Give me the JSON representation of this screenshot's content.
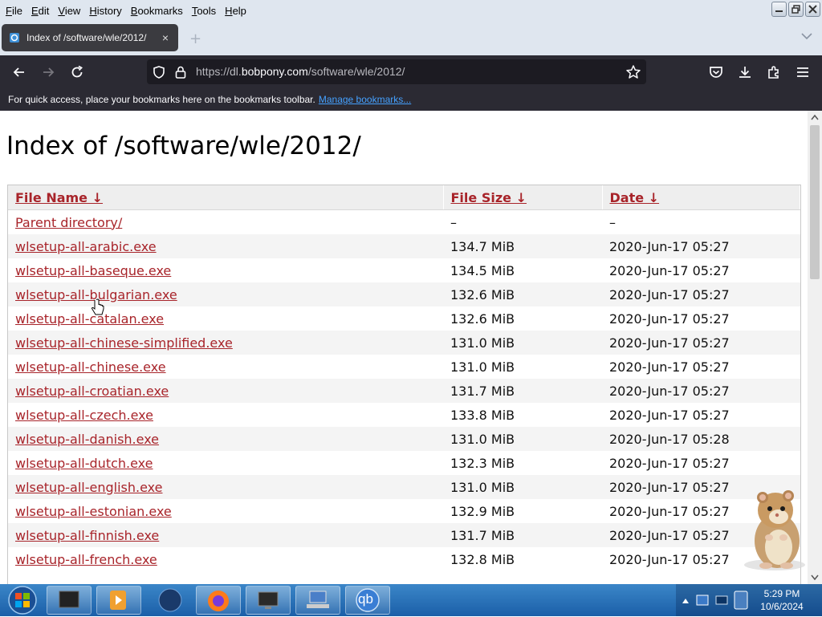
{
  "menu": {
    "items": [
      {
        "key": "F",
        "rest": "ile"
      },
      {
        "key": "E",
        "rest": "dit"
      },
      {
        "key": "V",
        "rest": "iew"
      },
      {
        "key": "H",
        "rest": "istory"
      },
      {
        "key": "B",
        "rest": "ookmarks"
      },
      {
        "key": "T",
        "rest": "ools"
      },
      {
        "key": "H",
        "rest": "elp"
      }
    ]
  },
  "tab": {
    "title": "Index of /software/wle/2012/",
    "close_glyph": "×",
    "new_tab_glyph": "+"
  },
  "url": {
    "prefix": "https://dl.",
    "domain": "bobpony.com",
    "path": "/software/wle/2012/"
  },
  "bookmarks_bar": {
    "message": "For quick access, place your bookmarks here on the bookmarks toolbar.",
    "link": "Manage bookmarks..."
  },
  "page": {
    "heading": "Index of /software/wle/2012/",
    "columns": {
      "name": "File Name  ↓",
      "size": "File Size  ↓",
      "date": "Date  ↓"
    },
    "rows": [
      {
        "name": "Parent directory/",
        "size": "–",
        "date": "–"
      },
      {
        "name": "wlsetup-all-arabic.exe",
        "size": "134.7 MiB",
        "date": "2020-Jun-17 05:27"
      },
      {
        "name": "wlsetup-all-baseque.exe",
        "size": "134.5 MiB",
        "date": "2020-Jun-17 05:27"
      },
      {
        "name": "wlsetup-all-bulgarian.exe",
        "size": "132.6 MiB",
        "date": "2020-Jun-17 05:27"
      },
      {
        "name": "wlsetup-all-catalan.exe",
        "size": "132.6 MiB",
        "date": "2020-Jun-17 05:27"
      },
      {
        "name": "wlsetup-all-chinese-simplified.exe",
        "size": "131.0 MiB",
        "date": "2020-Jun-17 05:27"
      },
      {
        "name": "wlsetup-all-chinese.exe",
        "size": "131.0 MiB",
        "date": "2020-Jun-17 05:27"
      },
      {
        "name": "wlsetup-all-croatian.exe",
        "size": "131.7 MiB",
        "date": "2020-Jun-17 05:27"
      },
      {
        "name": "wlsetup-all-czech.exe",
        "size": "133.8 MiB",
        "date": "2020-Jun-17 05:27"
      },
      {
        "name": "wlsetup-all-danish.exe",
        "size": "131.0 MiB",
        "date": "2020-Jun-17 05:28"
      },
      {
        "name": "wlsetup-all-dutch.exe",
        "size": "132.3 MiB",
        "date": "2020-Jun-17 05:27"
      },
      {
        "name": "wlsetup-all-english.exe",
        "size": "131.0 MiB",
        "date": "2020-Jun-17 05:27"
      },
      {
        "name": "wlsetup-all-estonian.exe",
        "size": "132.9 MiB",
        "date": "2020-Jun-17 05:27"
      },
      {
        "name": "wlsetup-all-finnish.exe",
        "size": "131.7 MiB",
        "date": "2020-Jun-17 05:27"
      },
      {
        "name": "wlsetup-all-french.exe",
        "size": "132.8 MiB",
        "date": "2020-Jun-17 05:27"
      }
    ]
  },
  "taskbar": {
    "time": "5:29 PM",
    "date": "10/6/2024",
    "qb_label": "qb"
  },
  "colors": {
    "link": "#a8242a",
    "toolbar": "#2b2a33",
    "urlfield": "#1c1b22",
    "accent_link": "#45a1ff"
  },
  "icons": [
    "back-icon",
    "forward-icon",
    "reload-icon",
    "shield-icon",
    "lock-icon",
    "star-icon",
    "pocket-icon",
    "download-icon",
    "extensions-icon",
    "menu-icon"
  ]
}
